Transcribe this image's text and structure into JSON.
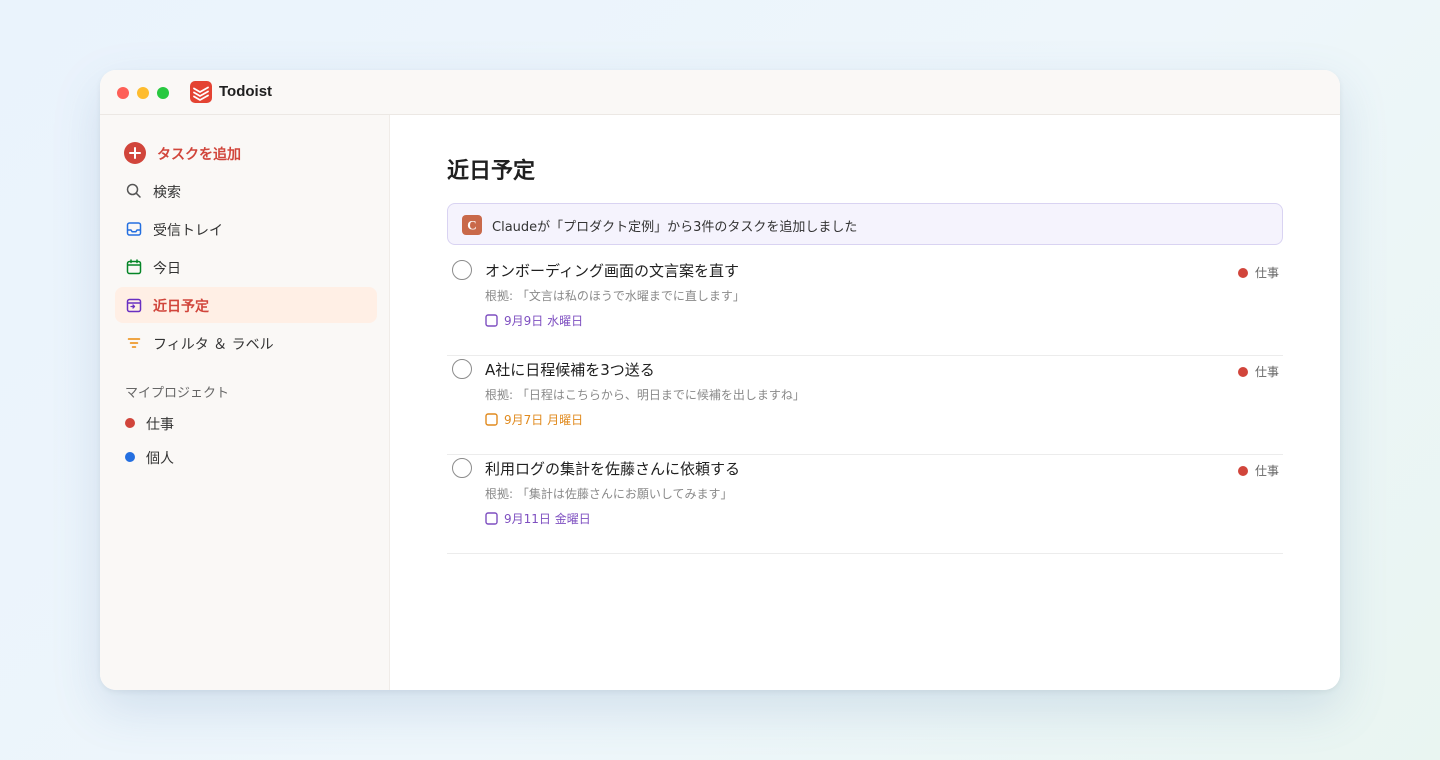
{
  "app": {
    "title": "Todoist"
  },
  "sidebar": {
    "add_task": {
      "label": "タスクを追加",
      "icon": "plus-circle-icon"
    },
    "items": [
      {
        "label": "検索",
        "icon": "search-icon"
      },
      {
        "label": "受信トレイ",
        "icon": "inbox-icon"
      },
      {
        "label": "今日",
        "icon": "calendar-today-icon"
      },
      {
        "label": "近日予定",
        "icon": "calendar-upcoming-icon",
        "active": true
      },
      {
        "label": "フィルタ ＆ ラベル",
        "icon": "filter-icon"
      }
    ],
    "projects_title": "マイプロジェクト",
    "projects": [
      {
        "label": "仕事",
        "color": "#d1453b"
      },
      {
        "label": "個人",
        "color": "#246fe0"
      }
    ]
  },
  "main": {
    "title": "近日予定",
    "banner": {
      "text": "Claudeが「プロダクト定例」から3件のタスクを追加しました",
      "icon": "claude-icon",
      "icon_letter": "C"
    },
    "tasks": [
      {
        "title": "オンボーディング画面の文言案を直す",
        "basis": "根拠: 「文言は私のほうで水曜までに直します」",
        "due": "9月9日 水曜日",
        "due_color": "#7e4fc0",
        "project": "仕事",
        "project_color": "#d1453b"
      },
      {
        "title": "A社に日程候補を3つ送る",
        "basis": "根拠: 「日程はこちらから、明日までに候補を出しますね」",
        "due": "9月7日 月曜日",
        "due_color": "#e08a1e",
        "project": "仕事",
        "project_color": "#d1453b"
      },
      {
        "title": "利用ログの集計を佐藤さんに依頼する",
        "basis": "根拠: 「集計は佐藤さんにお願いしてみます」",
        "due": "9月11日 金曜日",
        "due_color": "#7e4fc0",
        "project": "仕事",
        "project_color": "#d1453b"
      }
    ]
  },
  "colors": {
    "accent": "#d1453b",
    "banner_bg": "#f5f3fd",
    "active_bg": "#ffefe5"
  }
}
